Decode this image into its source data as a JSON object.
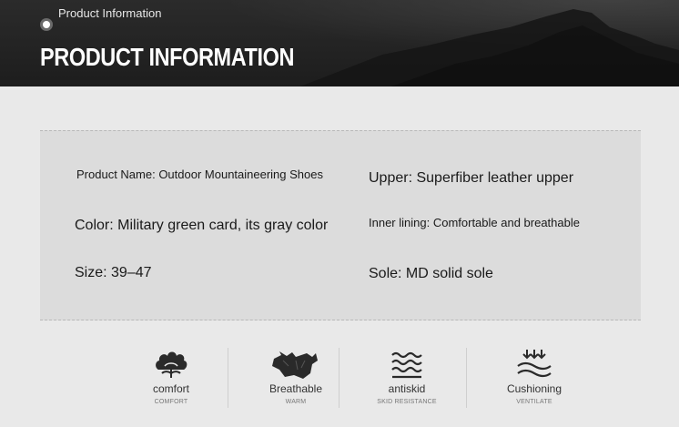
{
  "banner": {
    "subtitle": "Product Information",
    "title": "PRODUCT INFORMATION"
  },
  "info": {
    "product_name": "Product Name: Outdoor Mountaineering Shoes",
    "upper": "Upper: Superfiber leather upper",
    "color": "Color: Military green card, its gray color",
    "inner_lining": "Inner lining: Comfortable and breathable",
    "size": "Size: 39–47",
    "sole": "Sole: MD solid sole"
  },
  "features": [
    {
      "icon": "cotton-flower-icon",
      "label": "comfort",
      "sublabel": "COMFORT"
    },
    {
      "icon": "fur-icon",
      "label": "Breathable",
      "sublabel": "WARM"
    },
    {
      "icon": "waves-icon",
      "label": "antiskid",
      "sublabel": "SKID RESISTANCE"
    },
    {
      "icon": "cushion-arrows-icon",
      "label": "Cushioning",
      "sublabel": "VENTILATE"
    }
  ]
}
